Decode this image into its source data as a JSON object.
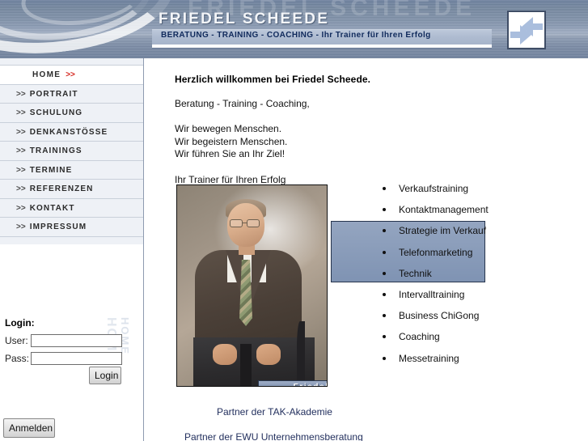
{
  "header": {
    "watermark_title": "FRIEDEL SCHEEDE",
    "title": "FRIEDEL SCHEEDE",
    "subtitle": "BERATUNG - TRAINING - COACHING - Ihr Trainer für Ihren Erfolg",
    "logo_icon": "double-arrow-icon",
    "band_color": "#aebbd0",
    "bg_color": "#7d8fa8",
    "title_color": "#f3f5f8",
    "subtitle_color": "#102a5c"
  },
  "sidebar": {
    "items": [
      {
        "label": "HOME",
        "chevron": ">>",
        "active": true
      },
      {
        "label": "PORTRAIT",
        "chevron": ">>",
        "active": false
      },
      {
        "label": "SCHULUNG",
        "chevron": ">>",
        "active": false
      },
      {
        "label": "DENKANSTÖSSE",
        "chevron": ">>",
        "active": false
      },
      {
        "label": "TRAININGS",
        "chevron": ">>",
        "active": false
      },
      {
        "label": "TERMINE",
        "chevron": ">>",
        "active": false
      },
      {
        "label": "REFERENZEN",
        "chevron": ">>",
        "active": false
      },
      {
        "label": "KONTAKT",
        "chevron": ">>",
        "active": false
      },
      {
        "label": "IMPRESSUM",
        "chevron": ">>",
        "active": false
      }
    ],
    "active_chevron_color": "#d4241c"
  },
  "login": {
    "title": "Login:",
    "user_label": "User:",
    "user_value": "",
    "user_placeholder": "",
    "pass_label": "Pass:",
    "pass_value": "",
    "pass_placeholder": "",
    "login_button": "Login",
    "anmelden_button": "Anmelden",
    "watermark": "HOME",
    "watermark2": "HOME"
  },
  "main": {
    "heading": "Herzlich willkommen bei Friedel Scheede.",
    "tagline": "Beratung - Training - Coaching,",
    "claims": [
      "Wir bewegen Menschen.",
      "Wir begeistern Menschen.",
      "Wir führen Sie an Ihr Ziel!"
    ],
    "slogan": "Ihr Trainer für Ihren Erfolg",
    "photo_caption": "Friedel Scheede",
    "photo_alt": "portrait-photo",
    "services": [
      "Verkaufstraining",
      "Kontaktmanagement",
      "Strategie im Verkauf",
      "Telefonmarketing",
      "Technik",
      "Intervalltraining",
      "Business ChiGong",
      "Coaching",
      "Messetraining"
    ],
    "partner1": "Partner der TAK-Akademie",
    "partner2": "Partner der EWU Unternehmensberatung",
    "partner_color": "#23305e"
  }
}
